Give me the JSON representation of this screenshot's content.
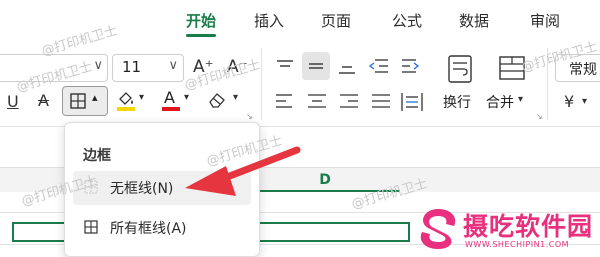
{
  "tabs": [
    "开始",
    "插入",
    "页面",
    "公式",
    "数据",
    "审阅"
  ],
  "ribbon": {
    "font_size": "11",
    "grow_font": "A⁺",
    "shrink_font": "A⁻",
    "underline": "U",
    "strike": "A",
    "fill_letter": "A",
    "wrap_label": "换行",
    "merge_label": "合并",
    "number_format": "常规",
    "currency": "¥"
  },
  "border_menu": {
    "title": "边框",
    "items": [
      {
        "label": "无框线(N)",
        "icon": "no-border-icon"
      },
      {
        "label": "所有框线(A)",
        "icon": "all-borders-icon"
      }
    ]
  },
  "sheet": {
    "column_d": "D"
  },
  "watermarks": [
    "@打印机卫士",
    "@打印机卫士",
    "@打印机卫士",
    "@打印机卫士",
    "@打印机卫士",
    "@打印机卫士",
    "@打印机卫士"
  ],
  "logo": {
    "title": "摄吃软件园",
    "subtitle": "WWW.SHECHIPIN1.COM"
  },
  "colors": {
    "accent": "#1a7c4a",
    "highlight_yellow": "#f5d600",
    "font_red": "#e0161d",
    "arrow_red": "#e5353f",
    "logo_pink": "#e8307e"
  }
}
